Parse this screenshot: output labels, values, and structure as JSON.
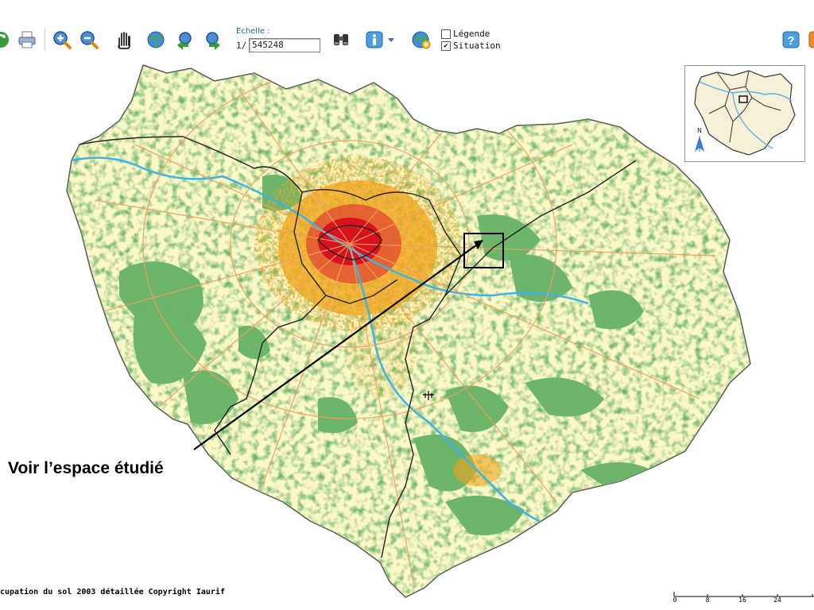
{
  "toolbar": {
    "scale": {
      "title": "Echelle :",
      "prefix": "1/",
      "value": "545248"
    },
    "layers": [
      {
        "label": "Légende",
        "checked": false
      },
      {
        "label": "Situation",
        "checked": true
      }
    ],
    "buttons": [
      "refresh-icon",
      "print-icon",
      "zoom-in-icon",
      "zoom-out-icon",
      "pan-hand-icon",
      "globe-full-extent-icon",
      "previous-view-icon",
      "next-view-icon",
      "binoculars-search-icon",
      "info-icon",
      "dropdown-arrow-icon",
      "globe-add-icon",
      "help-icon"
    ]
  },
  "map": {
    "annotation": "Voir l’espace étudié",
    "copyright": "cupation du sol 2003 détaillée Copyright Iaurif",
    "inset_north": "N",
    "scalebar_ticks": [
      "0",
      "8",
      "16",
      "24"
    ]
  },
  "colors": {
    "background_fill": "#fbf7c7",
    "forest": "#6db56b",
    "urban_dense": "#d8121f",
    "urban": "#f2a51c",
    "roads": "#f0a060",
    "water": "#3ab5e6",
    "border": "#222222",
    "study_area_box": "#000000"
  }
}
